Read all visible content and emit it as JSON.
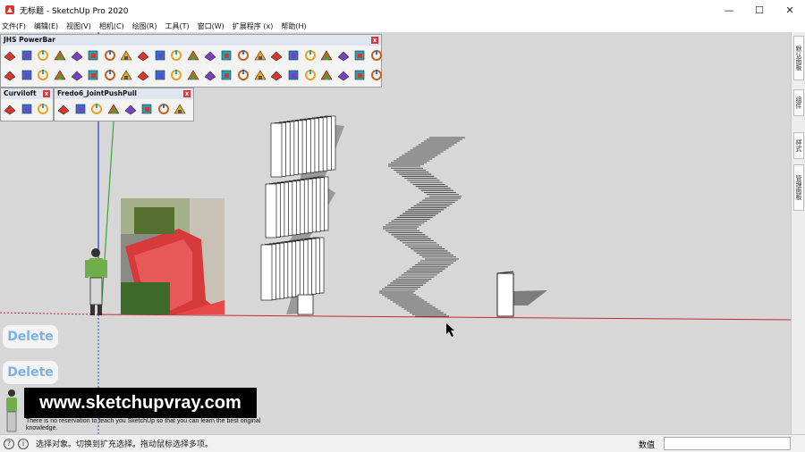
{
  "window": {
    "title": "无标题 - SketchUp Pro 2020",
    "minimize_glyph": "—",
    "maximize_glyph": "☐",
    "close_glyph": "✕"
  },
  "menu": [
    "文件(F)",
    "编辑(E)",
    "视图(V)",
    "相机(C)",
    "绘图(R)",
    "工具(T)",
    "窗口(W)",
    "扩展程序 (x)",
    "帮助(H)"
  ],
  "toolbars": {
    "jhs": {
      "title": "JHS PowerBar",
      "row1_count": 23,
      "row2_count": 23
    },
    "curviloft": {
      "title": "Curviloft",
      "icon_count": 3
    },
    "fredo": {
      "title": "Fredo6_JointPushPull",
      "icon_count": 8
    },
    "close_glyph": "x"
  },
  "tray_tabs": [
    "默认面板",
    "组件",
    "样式",
    "管理面板"
  ],
  "overlays": {
    "delete_label": "Delete",
    "watermark": "www.sketchupvray.com",
    "caption": "There is no reservation to teach you SketchUp so that you can learn the best original knowledge."
  },
  "status": {
    "text": "选择对象。切换到扩充选择。拖动鼠标选择多项。",
    "measurements_label": "数值",
    "measurements_value": "",
    "icon1": "?",
    "icon2": "i"
  },
  "colors": {
    "viewport_bg": "#d7d7d7",
    "red_axis": "#c62828",
    "green_axis": "#3aa63a",
    "blue_axis": "#2a3fbf",
    "delete_text": "#7ab0e8"
  }
}
